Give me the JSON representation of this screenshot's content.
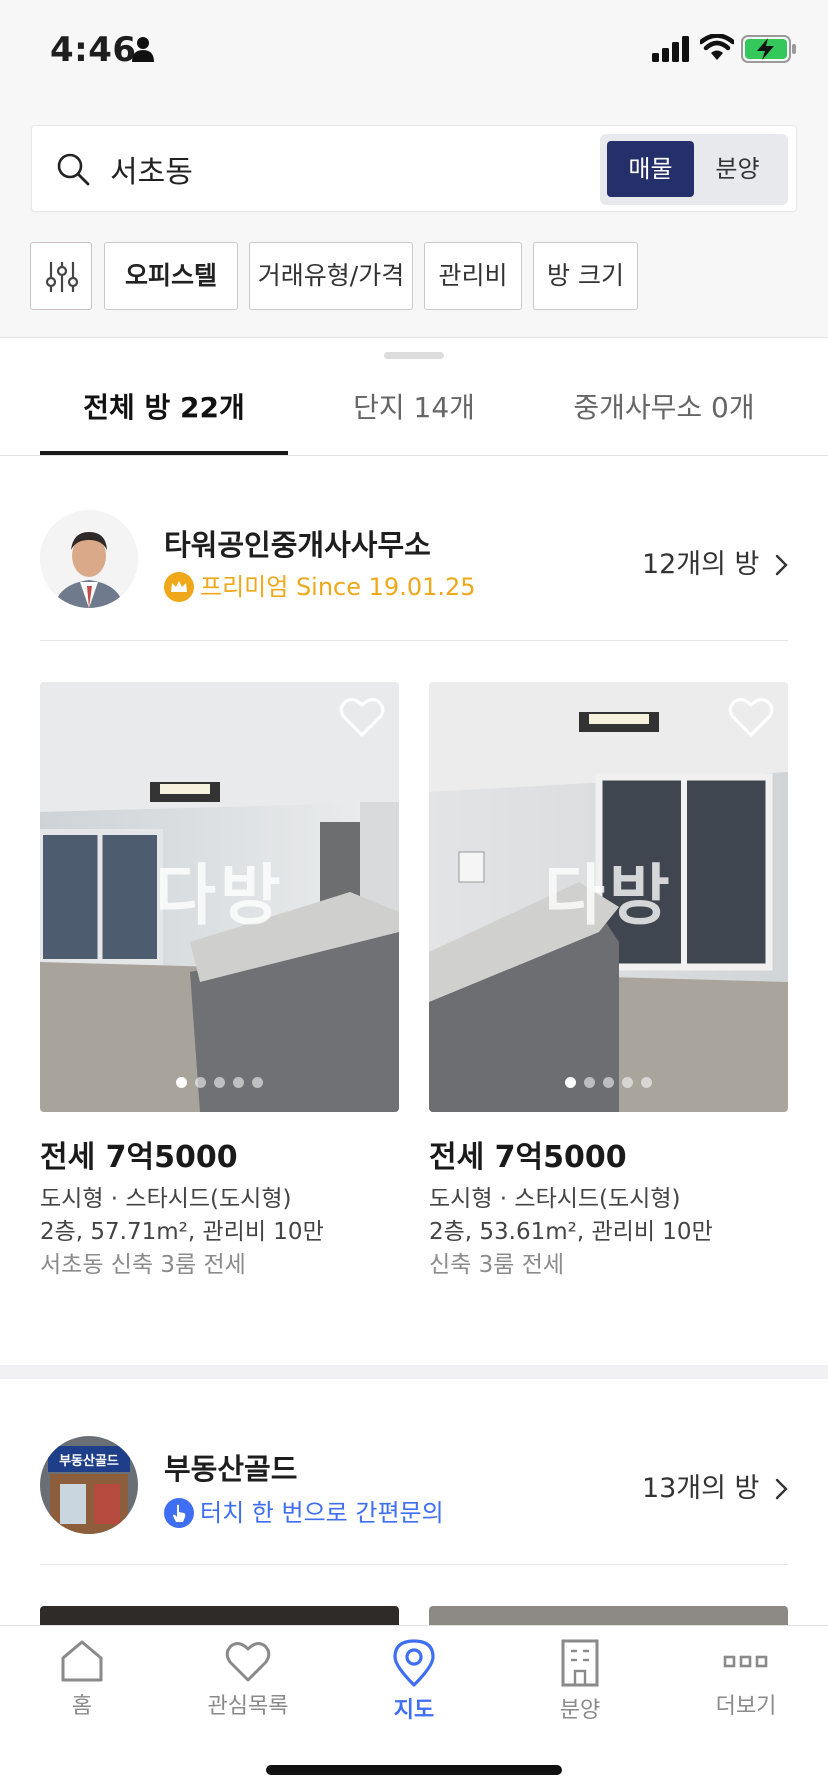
{
  "status_bar": {
    "time": "4:46"
  },
  "search": {
    "query": "서초동",
    "mode_selected": "매물",
    "mode_other": "분양"
  },
  "filters": [
    "오피스텔",
    "거래유형/가격",
    "관리비",
    "방 크기"
  ],
  "tabs": [
    {
      "label": "전체 방 22개",
      "active": true
    },
    {
      "label": "단지 14개",
      "active": false
    },
    {
      "label": "중개사무소 0개",
      "active": false
    }
  ],
  "agents": [
    {
      "name": "타워공인중개사사무소",
      "badge_text": "프리미엄 Since 19.01.25",
      "room_count": "12개의 방",
      "listings": [
        {
          "price": "전세 7억5000",
          "type": "도시형 · 스타시드(도시형)",
          "detail": "2층, 57.71m², 관리비 10만",
          "desc": "서초동 신축 3룸 전세",
          "watermark": "다방"
        },
        {
          "price": "전세 7억5000",
          "type": "도시형 · 스타시드(도시형)",
          "detail": "2층, 53.61m², 관리비 10만",
          "desc": "신축 3룸 전세",
          "watermark": "다방"
        }
      ]
    },
    {
      "name": "부동산골드",
      "badge_text": "터치 한 번으로 간편문의",
      "room_count": "13개의 방",
      "avatar_sign": "부동산골드"
    }
  ],
  "bottom_nav": [
    {
      "label": "홈",
      "icon": "home-icon"
    },
    {
      "label": "관심목록",
      "icon": "heart-icon"
    },
    {
      "label": "지도",
      "icon": "map-pin-icon",
      "active": true
    },
    {
      "label": "분양",
      "icon": "building-icon"
    },
    {
      "label": "더보기",
      "icon": "more-icon"
    }
  ],
  "colors": {
    "accent_navy": "#252f6a",
    "premium_gold": "#f0a81b",
    "link_blue": "#3e6ef2"
  }
}
